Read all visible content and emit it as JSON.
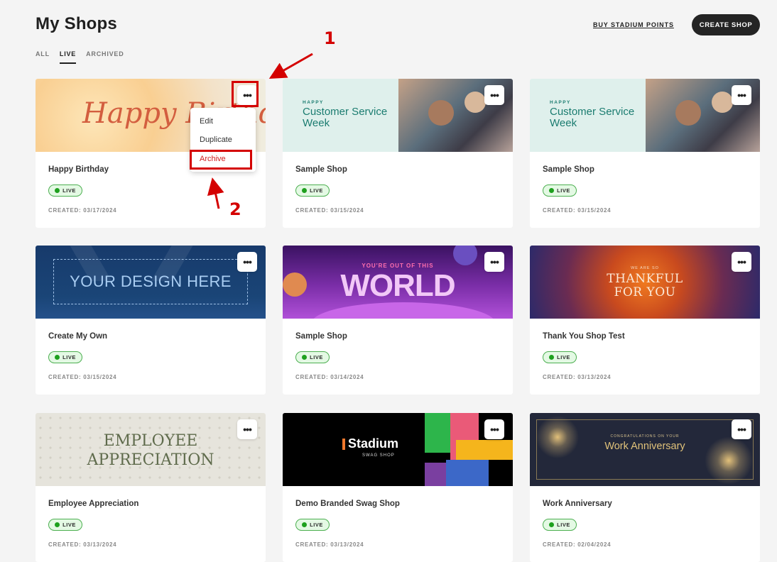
{
  "header": {
    "title": "My Shops",
    "buy_link": "BUY STADIUM POINTS",
    "create_button": "CREATE SHOP"
  },
  "tabs": [
    {
      "label": "ALL",
      "active": false
    },
    {
      "label": "LIVE",
      "active": true
    },
    {
      "label": "ARCHIVED",
      "active": false
    }
  ],
  "shops": [
    {
      "name": "Happy Birthday",
      "status": "LIVE",
      "created": "CREATED: 03/17/2024",
      "banner_text": "Happy Birthd"
    },
    {
      "name": "Sample Shop",
      "status": "LIVE",
      "created": "CREATED: 03/15/2024",
      "banner_small": "HAPPY",
      "banner_text": "Customer Service Week"
    },
    {
      "name": "Sample Shop",
      "status": "LIVE",
      "created": "CREATED: 03/15/2024",
      "banner_small": "HAPPY",
      "banner_text": "Customer Service Week"
    },
    {
      "name": "Create My Own",
      "status": "LIVE",
      "created": "CREATED: 03/15/2024",
      "banner_text": "YOUR DESIGN HERE"
    },
    {
      "name": "Sample Shop",
      "status": "LIVE",
      "created": "CREATED: 03/14/2024",
      "banner_small": "YOU'RE OUT OF THIS",
      "banner_text": "WORLD"
    },
    {
      "name": "Thank You Shop Test",
      "status": "LIVE",
      "created": "CREATED: 03/13/2024",
      "banner_small": "WE ARE SO",
      "banner_text": "THANKFUL FOR YOU"
    },
    {
      "name": "Employee Appreciation",
      "status": "LIVE",
      "created": "CREATED: 03/13/2024",
      "banner_text": "EMPLOYEE APPRECIATION"
    },
    {
      "name": "Demo Branded Swag Shop",
      "status": "LIVE",
      "created": "CREATED: 03/13/2024",
      "banner_text": "Stadium",
      "banner_small": "SWAG SHOP"
    },
    {
      "name": "Work Anniversary",
      "status": "LIVE",
      "created": "CREATED: 02/04/2024",
      "banner_small": "CONGRATULATIONS ON YOUR",
      "banner_text": "Work Anniversary"
    }
  ],
  "menu": {
    "items": [
      "Edit",
      "Duplicate",
      "Archive"
    ]
  },
  "annotations": {
    "step1": "1",
    "step2": "2",
    "color": "#d40000"
  },
  "colors": {
    "live_green": "#1ea01e",
    "button_dark": "#242424"
  }
}
